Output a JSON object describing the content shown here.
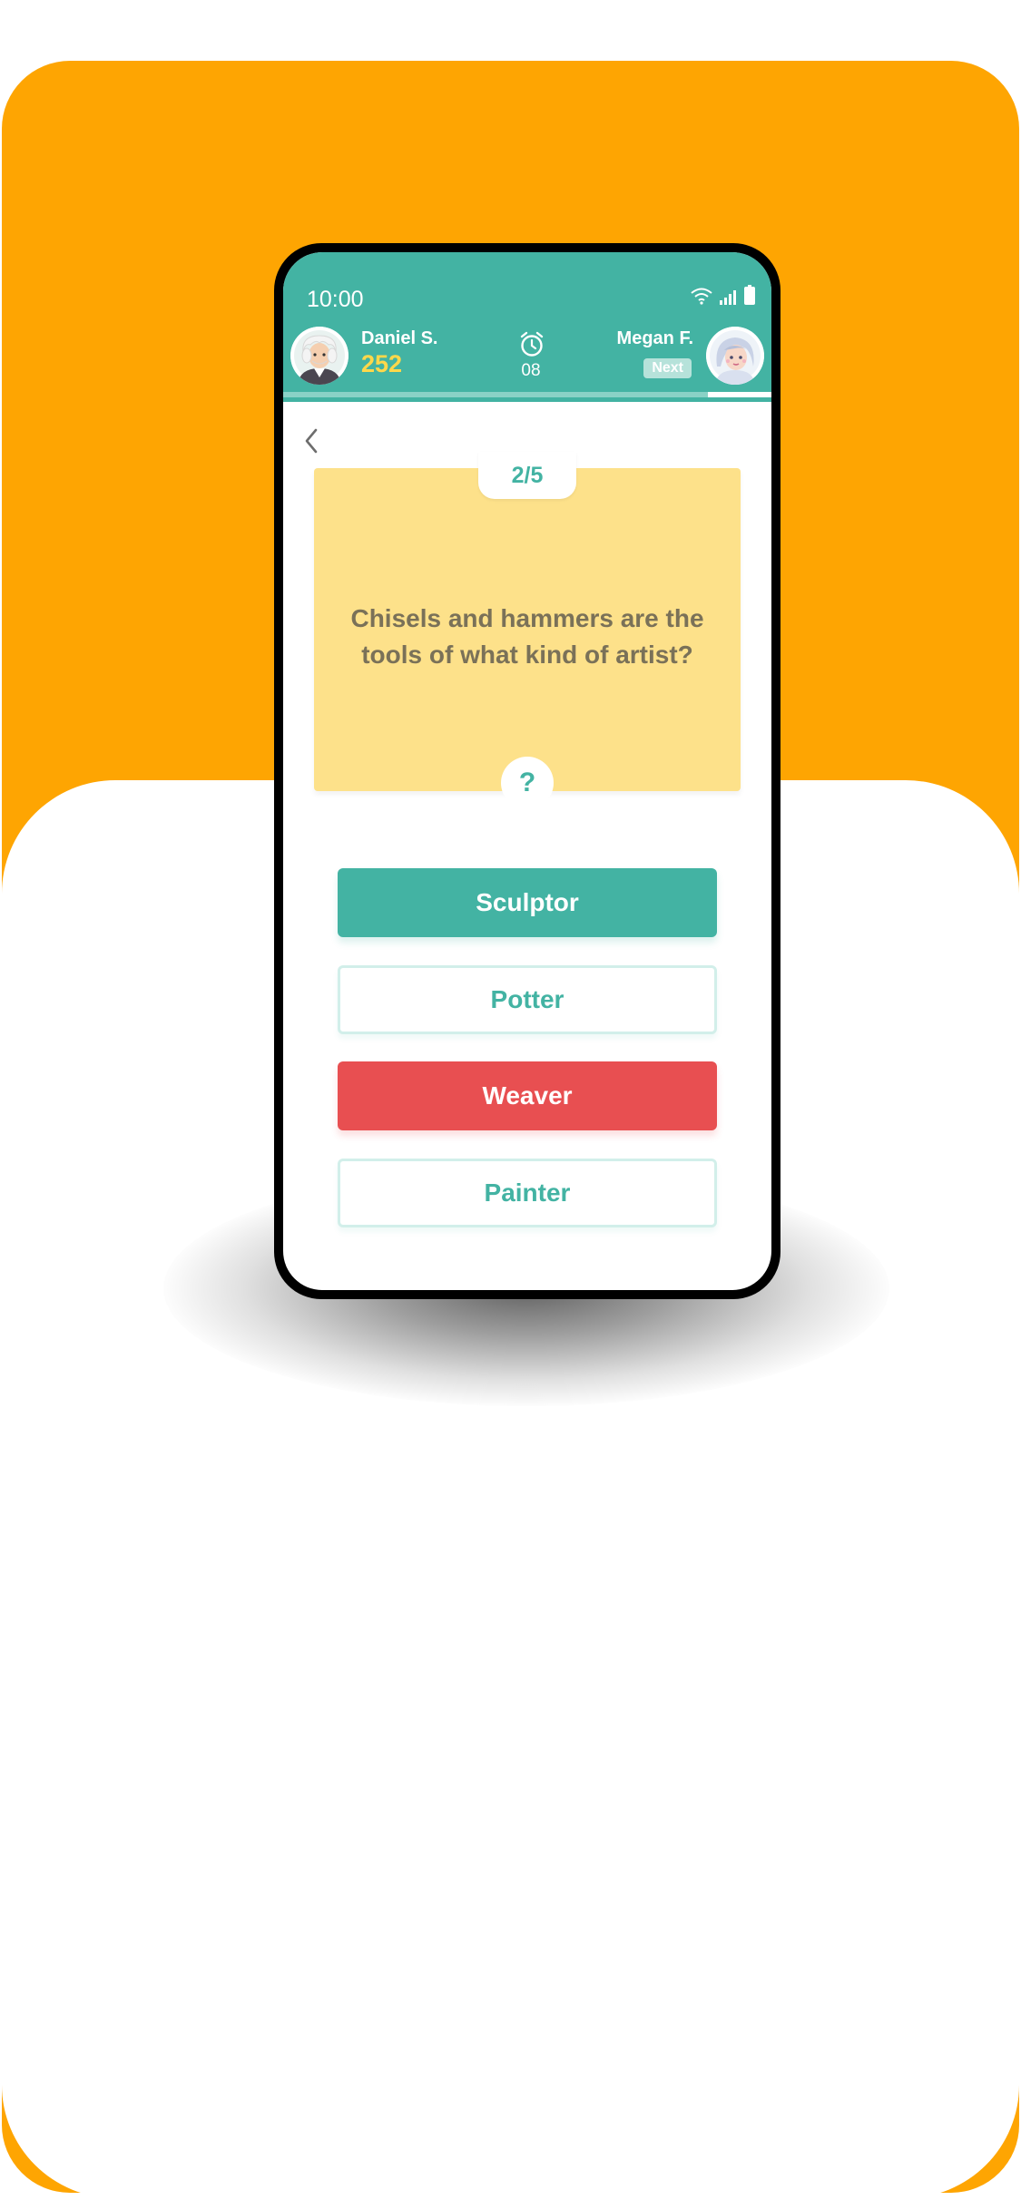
{
  "status": {
    "time": "10:00"
  },
  "players": {
    "left": {
      "name": "Daniel S.",
      "score": "252"
    },
    "right": {
      "name": "Megan F.",
      "badge": "Next"
    }
  },
  "timer": {
    "value": "08"
  },
  "progress": {
    "fraction": 0.87
  },
  "question": {
    "counter": "2/5",
    "text": "Chisels and hammers are the tools of what kind of artist?",
    "help_label": "?"
  },
  "answers": [
    {
      "label": "Sculptor",
      "state": "correct"
    },
    {
      "label": "Potter",
      "state": "default"
    },
    {
      "label": "Weaver",
      "state": "wrong"
    },
    {
      "label": "Painter",
      "state": "default"
    }
  ],
  "colors": {
    "orange": "#fea502",
    "teal": "#43b3a3",
    "card": "#fde18a",
    "wrong": "#e84f51",
    "score": "#ffd84a"
  },
  "icons": [
    "wifi-icon",
    "signal-icon",
    "battery-icon",
    "alarm-clock-icon",
    "back-chevron-icon",
    "old-man-avatar",
    "girl-avatar"
  ]
}
